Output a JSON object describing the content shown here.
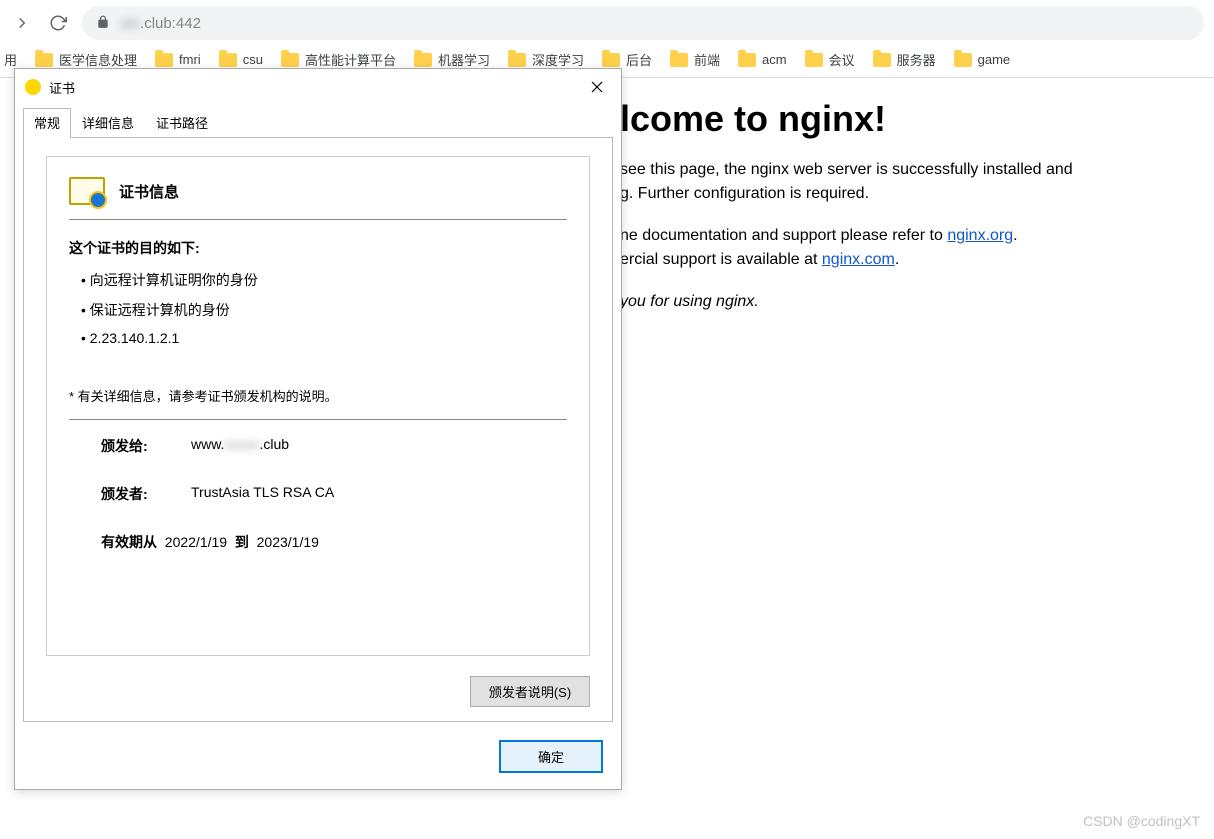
{
  "browser": {
    "url_host_blurred": "uio",
    "url_suffix": ".club",
    "url_port": ":442"
  },
  "bookmarks": {
    "first": "用",
    "items": [
      "医学信息处理",
      "fmri",
      "csu",
      "高性能计算平台",
      "机器学习",
      "深度学习",
      "后台",
      "前端",
      "acm",
      "会议",
      "服务器",
      "game"
    ]
  },
  "nginx": {
    "title_visible": "lcome to nginx!",
    "p1a": "see this page, the nginx web server is successfully installed and",
    "p1b": "g. Further configuration is required.",
    "p2a": "ne documentation and support please refer to ",
    "p2a_link": "nginx.org",
    "p2b": "ercial support is available at ",
    "p2b_link": "nginx.com",
    "thanks": "you for using nginx."
  },
  "cert": {
    "window_title": "证书",
    "tabs": {
      "general": "常规",
      "details": "详细信息",
      "path": "证书路径"
    },
    "heading": "证书信息",
    "purpose_label": "这个证书的目的如下:",
    "purposes": [
      "向远程计算机证明你的身份",
      "保证远程计算机的身份",
      "2.23.140.1.2.1"
    ],
    "footnote": "* 有关详细信息，请参考证书颁发机构的说明。",
    "issued_to_label": "颁发给:",
    "issued_to_prefix": "www.",
    "issued_to_blurred": "xxxxx",
    "issued_to_suffix": ".club",
    "issued_by_label": "颁发者:",
    "issued_by": "TrustAsia TLS RSA CA",
    "valid_from_label": "有效期从",
    "valid_from": "2022/1/19",
    "valid_to_label": "到",
    "valid_to": "2023/1/19",
    "issuer_statement_btn": "颁发者说明(S)",
    "ok_btn": "确定"
  },
  "watermark": "CSDN @codingXT"
}
